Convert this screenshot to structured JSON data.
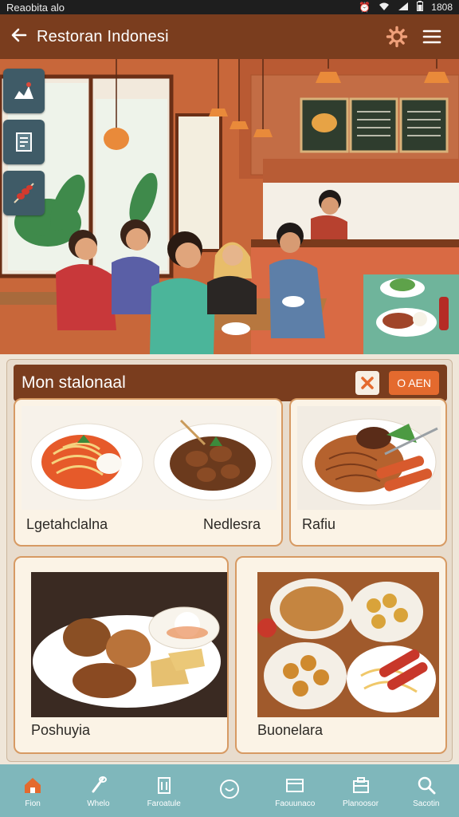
{
  "status_bar": {
    "carrier": "Reaobita alo",
    "time": "1808"
  },
  "app_bar": {
    "title": "Restoran Indonesi"
  },
  "menu": {
    "title": "Mon stalonaal",
    "open_label": "O AEN",
    "items": [
      {
        "label": "Lgetahclalna"
      },
      {
        "label": "Nedlesra"
      },
      {
        "label": "Rafiu"
      },
      {
        "label": "Poshuyia"
      },
      {
        "label": "Buonelara"
      }
    ]
  },
  "bottom_nav": {
    "items": [
      {
        "label": "Fion",
        "icon": "home-icon"
      },
      {
        "label": "Whelo",
        "icon": "utensil-icon"
      },
      {
        "label": "Faroatule",
        "icon": "building-icon"
      },
      {
        "label": "",
        "icon": "smile-icon"
      },
      {
        "label": "Faouunaco",
        "icon": "card-icon"
      },
      {
        "label": "Planoosor",
        "icon": "store-icon"
      },
      {
        "label": "Sacotin",
        "icon": "search-icon"
      }
    ]
  },
  "colors": {
    "brand": "#7a3d1e",
    "accent": "#e46a2e",
    "nav": "#7fb7bb"
  }
}
